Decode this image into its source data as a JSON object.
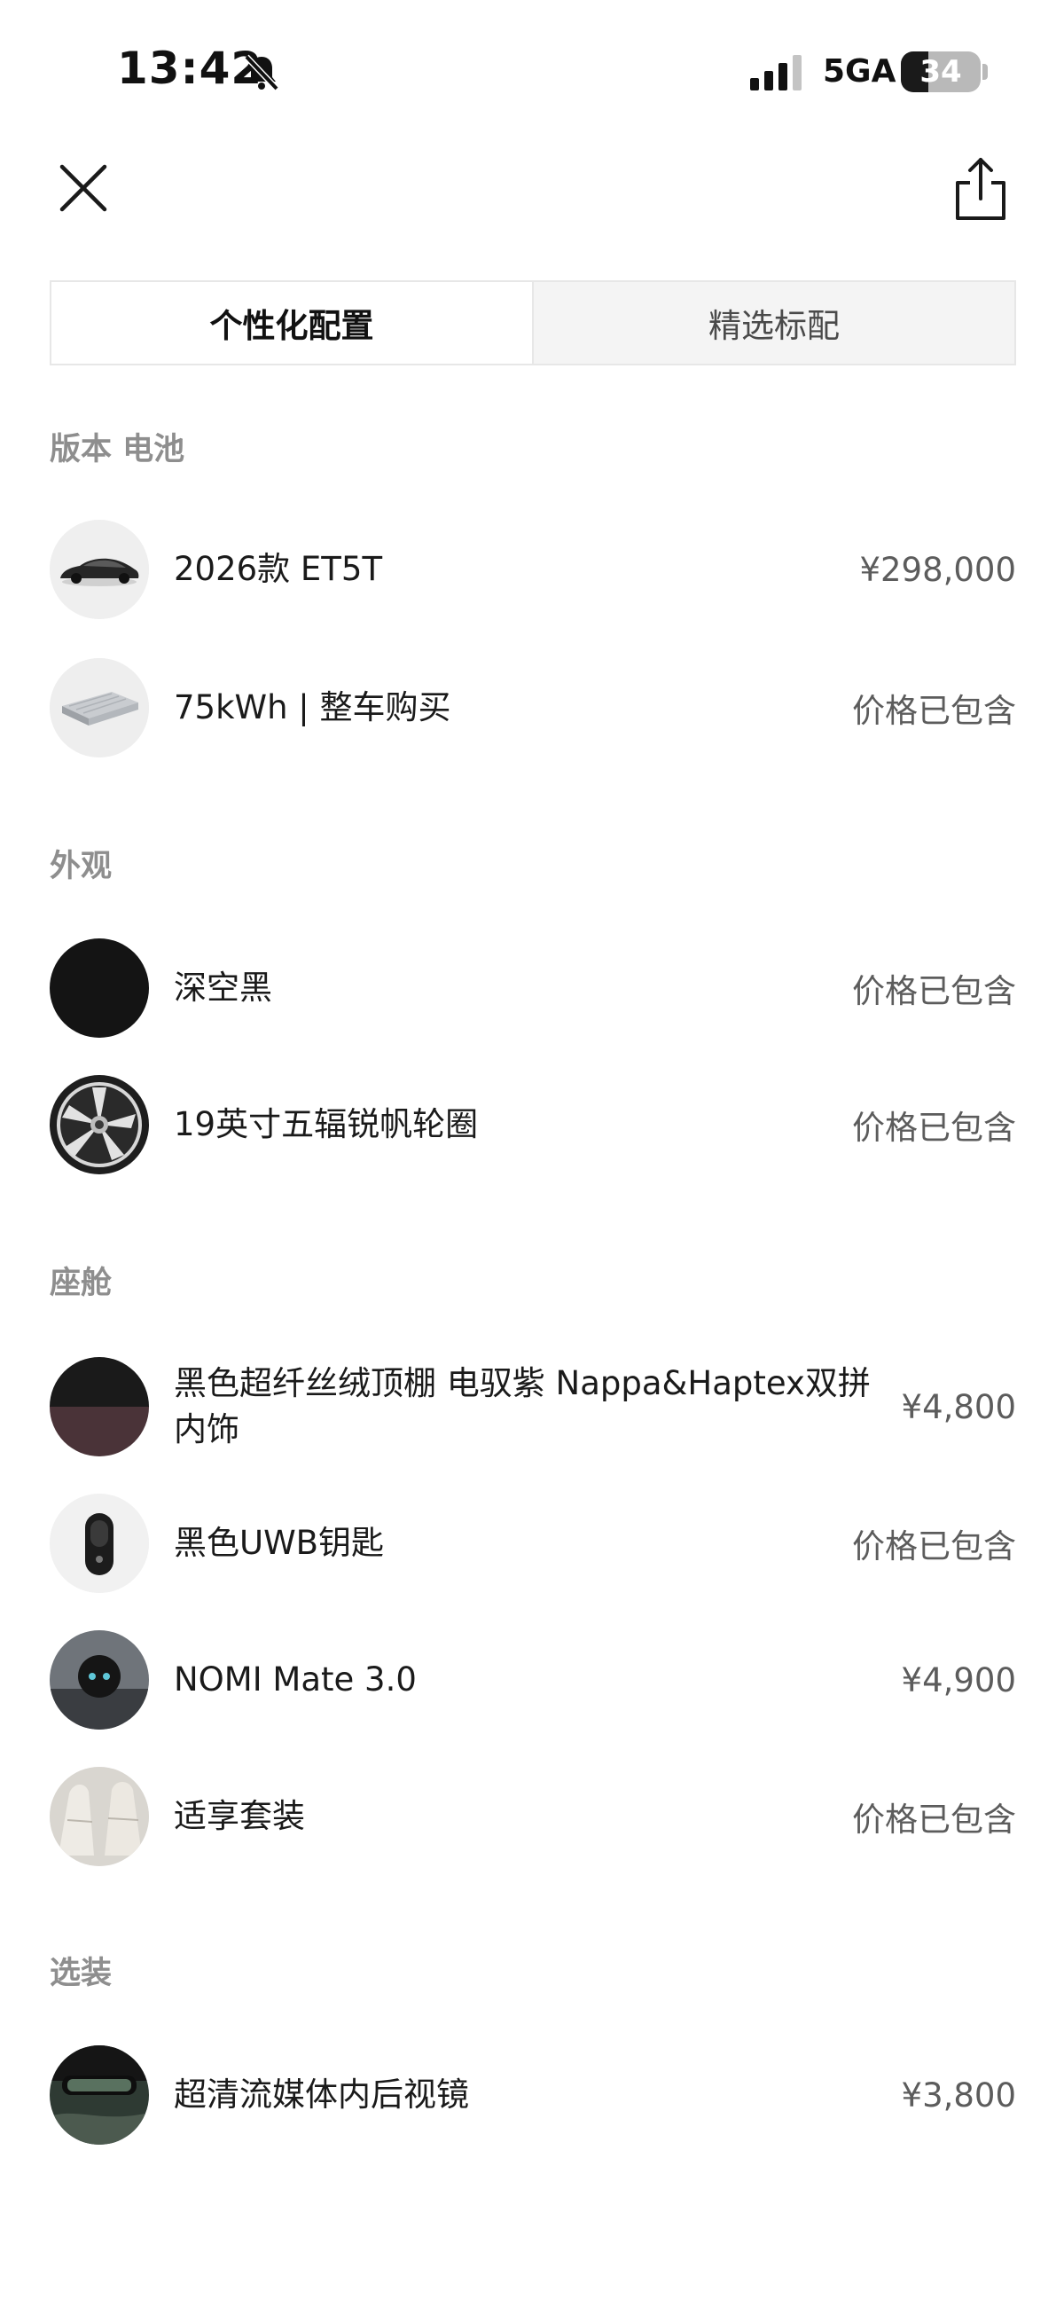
{
  "status_bar": {
    "time": "13:42",
    "network": "5GA",
    "battery": "34",
    "battery_level": 0.34
  },
  "header": {
    "close_icon": "close-icon",
    "share_icon": "share-icon"
  },
  "tabs": [
    {
      "label": "个性化配置",
      "active": true
    },
    {
      "label": "精选标配",
      "active": false
    }
  ],
  "sections": {
    "version": {
      "title": "版本 电池",
      "items": [
        {
          "label": "2026款 ET5T",
          "price": "¥298,000",
          "thumb": "car-image"
        },
        {
          "label": "75kWh | 整车购买",
          "price": "价格已包含",
          "thumb": "battery-pack-image"
        }
      ]
    },
    "exterior": {
      "title": "外观",
      "items": [
        {
          "label": "深空黑",
          "price": "价格已包含",
          "thumb": "color-swatch",
          "color": "#141414"
        },
        {
          "label": "19英寸五辐锐帆轮圈",
          "price": "价格已包含",
          "thumb": "wheel-image"
        }
      ]
    },
    "cabin": {
      "title": "座舱",
      "items": [
        {
          "label": "黑色超纤丝绒顶棚 电驭紫 Nappa&Haptex双拼内饰",
          "price": "¥4,800",
          "thumb": "interior-swatch"
        },
        {
          "label": "黑色UWB钥匙",
          "price": "价格已包含",
          "thumb": "key-image"
        },
        {
          "label": "NOMI Mate 3.0",
          "price": "¥4,900",
          "thumb": "nomi-image"
        },
        {
          "label": "适享套装",
          "price": "价格已包含",
          "thumb": "seat-image"
        }
      ]
    },
    "options": {
      "title": "选装",
      "items": [
        {
          "label": "超清流媒体内后视镜",
          "price": "¥3,800",
          "thumb": "mirror-image"
        }
      ]
    }
  }
}
